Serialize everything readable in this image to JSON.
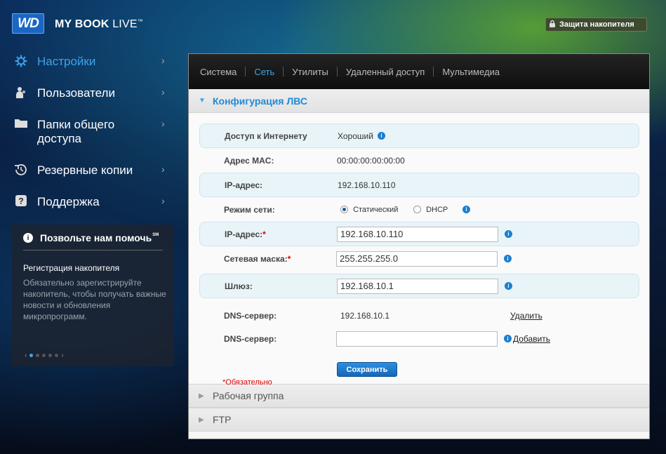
{
  "header": {
    "logo": "WD",
    "product_brand": "MY BOOK",
    "product_sub": " LIVE",
    "tm": "™",
    "lock_button": "Защита накопителя",
    "lock_icon": "lock-icon"
  },
  "sidebar": {
    "items": [
      {
        "label": "Настройки",
        "icon": "gear-icon",
        "active": true
      },
      {
        "label": "Пользователи",
        "icon": "user-icon",
        "active": false
      },
      {
        "label": "Папки общего доступа",
        "icon": "folder-icon",
        "active": false
      },
      {
        "label": "Резервные копии",
        "icon": "backup-icon",
        "active": false
      },
      {
        "label": "Поддержка",
        "icon": "help-icon",
        "active": false
      }
    ]
  },
  "help_panel": {
    "title": "Позвольте нам помочь",
    "title_mark": "SM",
    "subtitle": "Регистрация накопителя",
    "text": "Обязательно зарегистрируйте накопитель, чтобы получать важные новости и обновления микропрограмм.",
    "pages": 5,
    "current_page": 1
  },
  "tabs": [
    {
      "label": "Система",
      "active": false
    },
    {
      "label": "Сеть",
      "active": true
    },
    {
      "label": "Утилиты",
      "active": false
    },
    {
      "label": "Удаленный доступ",
      "active": false
    },
    {
      "label": "Мультимедиа",
      "active": false
    }
  ],
  "lan_section": {
    "title": "Конфигурация ЛВС",
    "internet_label": "Доступ к Интернету",
    "internet_value": "Хороший",
    "mac_label": "Адрес MAC:",
    "mac_value": "00:00:00:00:00:00",
    "ip_label": "IP-адрес:",
    "ip_value": "192.168.10.110",
    "mode_label": "Режим сети:",
    "mode_static": "Статический",
    "mode_dhcp": "DHCP",
    "mode_selected": "static",
    "ip_input_label": "IP-адрес:",
    "ip_input_value": "192.168.10.110",
    "mask_label": "Сетевая маска:",
    "mask_value": "255.255.255.0",
    "gateway_label": "Шлюз:",
    "gateway_value": "192.168.10.1",
    "dns1_label": "DNS-сервер:",
    "dns1_value": "192.168.10.1",
    "dns1_action": "Удалить",
    "dns2_label": "DNS-сервер:",
    "dns2_value": "",
    "dns2_action": "Добавить",
    "save_button": "Сохранить",
    "required_note": "*Обязательно",
    "required_mark": "*"
  },
  "collapsed_sections": [
    {
      "title": "Рабочая группа"
    },
    {
      "title": "FTP"
    }
  ],
  "colors": {
    "accent": "#3fa3e8",
    "required": "#dd0000",
    "button": "#1f7ad0"
  }
}
